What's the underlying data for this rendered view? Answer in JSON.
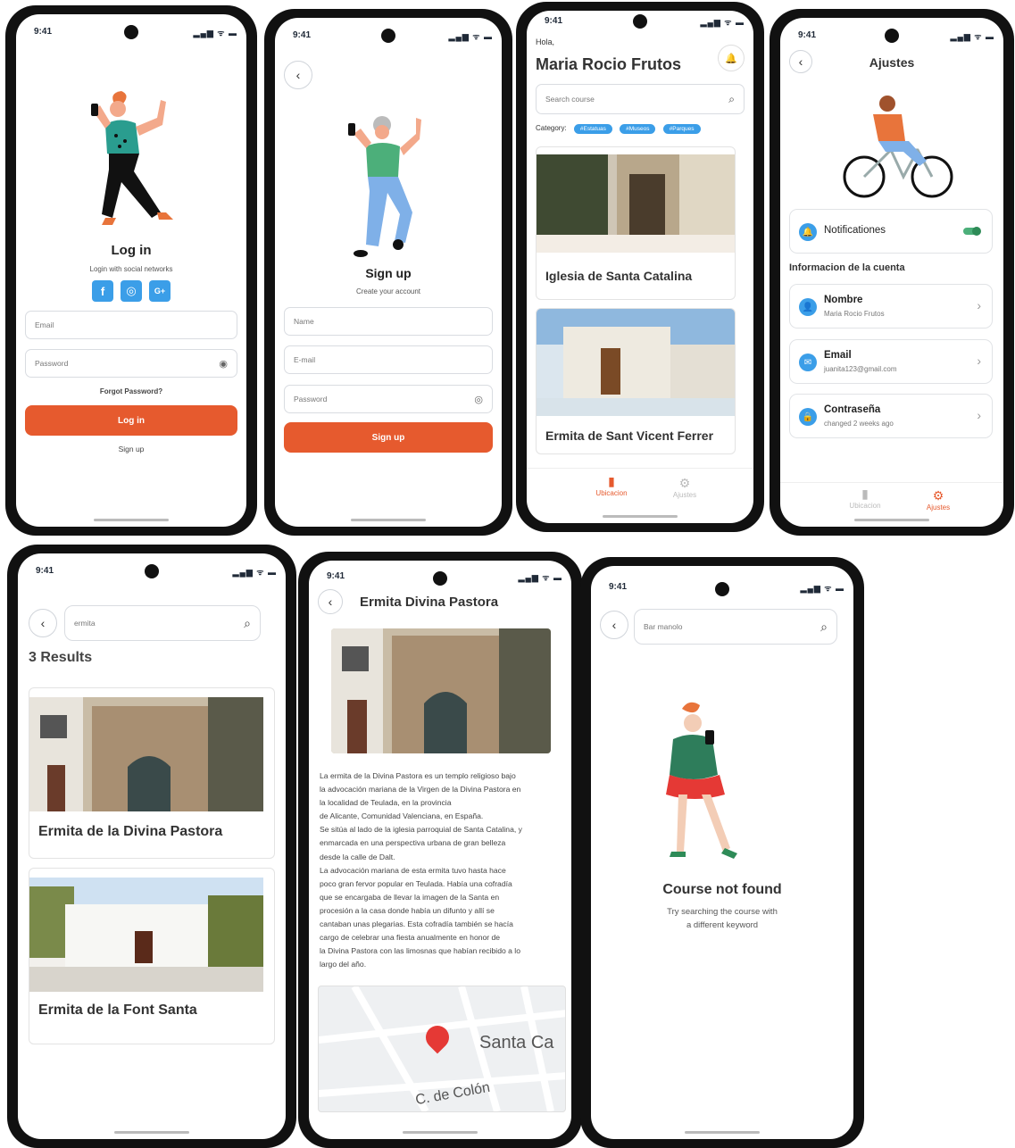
{
  "status": {
    "time": "9:41",
    "icons": "▂▄▆ ᯤ ▬"
  },
  "login": {
    "title": "Log in",
    "subtitle": "Login with social networks",
    "social": [
      "f",
      "◎",
      "G+"
    ],
    "email_placeholder": "Email",
    "password_placeholder": "Password",
    "forgot": "Forgot Password?",
    "button": "Log in",
    "signup_link": "Sign up",
    "eye": "◉"
  },
  "signup": {
    "back": "‹",
    "title": "Sign up",
    "subtitle": "Create your account",
    "name_placeholder": "Name",
    "email_placeholder": "E-mail",
    "password_placeholder": "Password",
    "button": "Sign up",
    "eye": "◎"
  },
  "home": {
    "greeting": "Hola,",
    "name": "Maria Rocio Frutos",
    "bell": "🔔",
    "search_placeholder": "Search course",
    "category_label": "Category:",
    "tags": [
      "#Estatuas",
      "#Museos",
      "#Parques"
    ],
    "cards": [
      "Iglesia de Santa Catalina",
      "Ermita de Sant Vicent Ferrer"
    ],
    "tab_location": "Ubicacion",
    "tab_settings": "Ajustes"
  },
  "settings": {
    "back": "‹",
    "title": "Ajustes",
    "notifications": "Notificationes",
    "notifications_on": true,
    "section": "Informacion de la cuenta",
    "items": [
      {
        "label": "Nombre",
        "value": "Maria Rocio Frutos",
        "icon": "👤"
      },
      {
        "label": "Email",
        "value": "juanita123@gmail.com",
        "icon": "✉"
      },
      {
        "label": "Contraseña",
        "value": "changed 2 weeks ago",
        "icon": "🔒"
      }
    ],
    "tab_location": "Ubicacion",
    "tab_settings": "Ajustes"
  },
  "results": {
    "back": "‹",
    "query": "ermita",
    "count": "3 Results",
    "cards": [
      "Ermita de la Divina Pastora",
      "Ermita de la Font Santa"
    ]
  },
  "detail": {
    "back": "‹",
    "title": "Ermita Divina Pastora",
    "description": [
      "La ermita de la Divina Pastora es un templo religioso bajo",
      "la advocación mariana de la Virgen de la Divina Pastora en",
      "la localidad de Teulada, en la provincia",
      "de Alicante, Comunidad Valenciana, en España.",
      "Se sitúa al lado de la iglesia parroquial de Santa Catalina, y",
      "enmarcada en una perspectiva urbana de gran belleza",
      "desde la calle de Dalt.",
      "La advocación mariana de esta ermita tuvo hasta hace",
      "poco gran fervor popular en Teulada. Había una cofradía",
      "que se encargaba de llevar la imagen de la Santa en",
      "procesión a la casa donde había un difunto y allí se",
      "cantaban unas plegarias. Esta cofradía también se hacía",
      "cargo de celebrar una fiesta anualmente en honor de",
      "la Divina Pastora con las limosnas que habían recibido a lo",
      "largo del año."
    ],
    "map_label": "Santa Ca",
    "map_street": "C. de Colón"
  },
  "notfound": {
    "back": "‹",
    "query": "Bar manolo",
    "title": "Course not found",
    "line1": "Try searching the course with",
    "line2": "a different keyword"
  },
  "colors": {
    "accent": "#e65a2e",
    "blue": "#3b9ee8",
    "green": "#2e8b57"
  }
}
